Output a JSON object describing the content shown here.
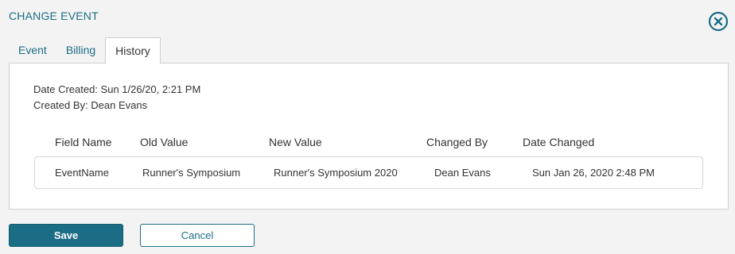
{
  "dialog": {
    "title": "CHANGE EVENT"
  },
  "tabs": [
    {
      "label": "Event"
    },
    {
      "label": "Billing"
    },
    {
      "label": "History"
    }
  ],
  "active_tab": "History",
  "history": {
    "date_created": "Date Created: Sun 1/26/20, 2:21 PM",
    "created_by": "Created By: Dean Evans",
    "columns": [
      "Field Name",
      "Old Value",
      "New Value",
      "Changed By",
      "Date Changed"
    ],
    "rows": [
      {
        "field_name": "EventName",
        "old_value": "Runner's Symposium",
        "new_value": "Runner's Symposium 2020",
        "changed_by": "Dean Evans",
        "date_changed": "Sun Jan 26, 2020 2:48 PM"
      }
    ]
  },
  "buttons": {
    "save": "Save",
    "cancel": "Cancel"
  },
  "colors": {
    "accent": "#1b6d85"
  },
  "icons": {
    "close": "close-circle-icon"
  }
}
